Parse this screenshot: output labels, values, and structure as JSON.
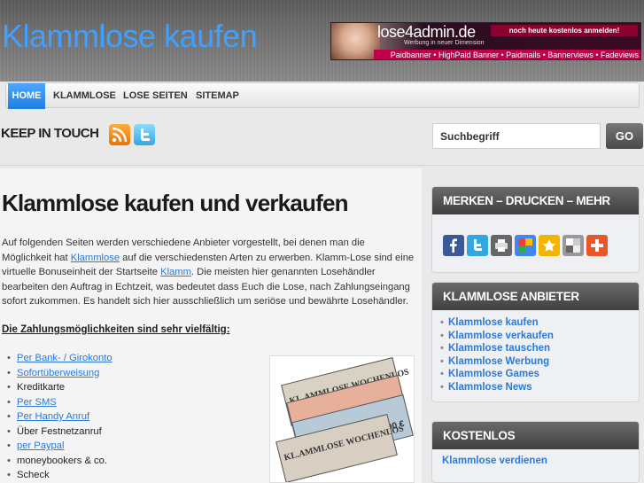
{
  "header": {
    "site_title": "Klammlose kaufen",
    "banner": {
      "logo": "lose4admin.de",
      "tagline": "Werbung in neuer Dimension",
      "cta": "noch heute kostenlos anmelden!",
      "strip": "Paidbanner • HighPaid Banner • Paidmails • Bannerviews • Fadeviews"
    }
  },
  "nav": {
    "items": [
      "HOME",
      "KLAMMLOSE",
      "LOSE SEITEN",
      "SITEMAP"
    ]
  },
  "touch": {
    "label": "KEEP IN TOUCH",
    "icons": [
      "rss-icon",
      "twitter-icon"
    ]
  },
  "search": {
    "value": "Suchbegriff",
    "button": "GO"
  },
  "post": {
    "title": "Klammlose kaufen und verkaufen",
    "p1a": "Auf folgenden Seiten werden verschiedene Anbieter vorgestellt, bei denen man die Möglichkeit hat ",
    "link1": "Klammlose",
    "p1b": " auf die verschiedensten Arten zu erwerben. Klamm-Lose sind eine virtuelle Bonuseinheit der Startseite ",
    "link2": "Klamm",
    "p1c": ". Die meisten hier genannten Losehändler bearbeiten den Auftrag in Echtzeit, was bedeutet dass Euch die Lose, nach Zahlungseingang sofort zukommen. Es handelt sich hier ausschließlich um seriöse und bewährte Losehändler.",
    "subhead": "Die Zahlungsmöglichkeiten sind sehr vielfältig:",
    "payments": [
      {
        "label": "Per Bank- / Girokonto",
        "link": true
      },
      {
        "label": "Sofortüberweisung",
        "link": true
      },
      {
        "label": "Kreditkarte",
        "link": false
      },
      {
        "label": "Per SMS",
        "link": true
      },
      {
        "label": "Per Handy Anruf",
        "link": true
      },
      {
        "label": "Über Festnetzanruf",
        "link": false
      },
      {
        "label": "per Paypal",
        "link": true
      },
      {
        "label": "moneybookers & co.",
        "link": false
      },
      {
        "label": "Scheck",
        "link": false
      }
    ],
    "ticket_text": "KL.AMMLOSE WOCHENLOS",
    "ticket_price": "25,00 €"
  },
  "sidebar": {
    "merken": {
      "title": "MERKEN – DRUCKEN – MEHR",
      "icons": [
        "facebook-icon",
        "twitter-icon",
        "print-icon",
        "google-icon",
        "favorite-star-icon",
        "delicious-icon",
        "add-more-icon"
      ]
    },
    "anbieter": {
      "title": "KLAMMLOSE ANBIETER",
      "links": [
        "Klammlose kaufen",
        "Klammlose verkaufen",
        "Klammlose tauschen",
        "Klammlose Werbung",
        "Klammlose Games",
        "Klammlose News"
      ]
    },
    "kostenlos": {
      "title": "KOSTENLOS",
      "link": "Klammlose verdienen"
    }
  },
  "colors": {
    "accent": "#3fa0ff",
    "link": "#2a7ad6",
    "widget_head": "#4f4f4f"
  }
}
